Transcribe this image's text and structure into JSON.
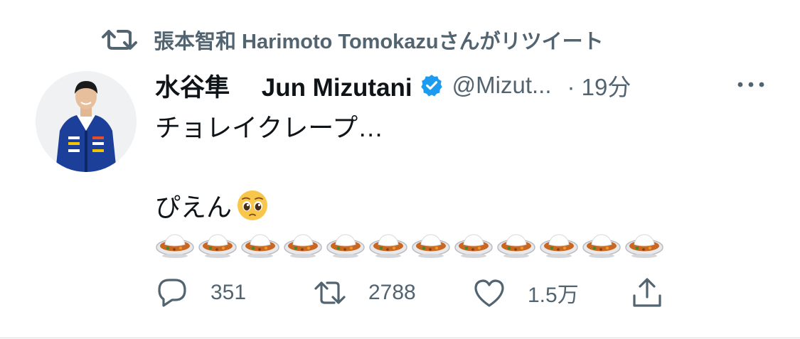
{
  "retweet": {
    "icon": "retweet-icon",
    "text": "張本智和 Harimoto Tomokazuさんがリツイート"
  },
  "tweet": {
    "display_name": "水谷隼　 Jun Mizutani",
    "handle": "@Mizut...",
    "time": "· 19分",
    "verified": true,
    "lines": [
      "チョレイクレープ…",
      "",
      "ぴえん"
    ],
    "pleading_emoji": "pleading-face",
    "curry_emoji_count": 12
  },
  "actions": {
    "reply_count": "351",
    "retweet_count": "2788",
    "like_count": "1.5万"
  },
  "colors": {
    "text": "#0f1419",
    "secondary": "#536471",
    "verified_blue": "#1d9bf0"
  }
}
